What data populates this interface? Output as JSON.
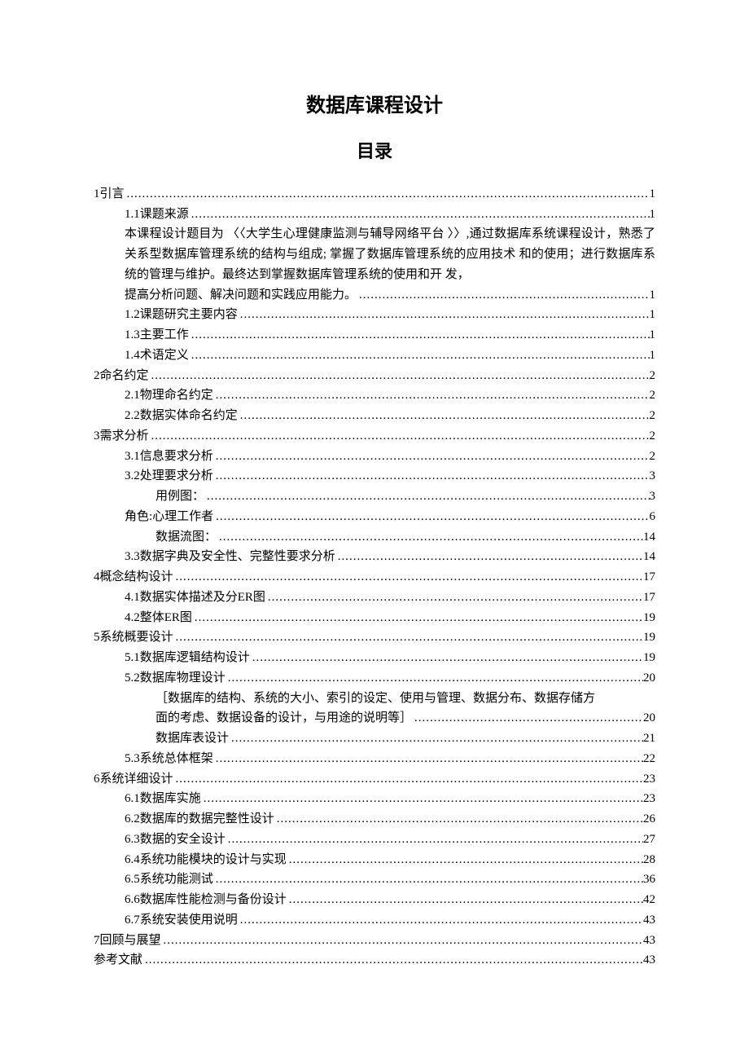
{
  "title": "数据库课程设计",
  "subtitle": "目录",
  "toc": [
    {
      "kind": "dotline",
      "indent": 0,
      "label": "1引言",
      "page": "1"
    },
    {
      "kind": "dotline",
      "indent": 1,
      "label": "1.1课题来源",
      "page": "1"
    },
    {
      "kind": "wrapblock",
      "indent": 1,
      "body": "本课程设计题目为 〈〈大学生心理健康监测与辅导网络平台  〉〉,通过数据库系统课程设计，熟悉了关系型数据库管理系统的结构与组成;  掌握了数据库管理系统的应用技术  和的使用；进行数据库系统的管理与维护。最终达到掌握数据库管理系统的使用和开  发，",
      "last": "提高分析问题、解决问题和实践应用能力。",
      "page": "1"
    },
    {
      "kind": "dotline",
      "indent": 1,
      "label": "1.2课题研究主要内容",
      "page": "1"
    },
    {
      "kind": "dotline",
      "indent": 1,
      "label": "1.3主要工作",
      "page": "1"
    },
    {
      "kind": "dotline",
      "indent": 1,
      "label": "1.4术语定义",
      "page": "1"
    },
    {
      "kind": "dotline",
      "indent": 0,
      "label": "2命名约定",
      "page": "2"
    },
    {
      "kind": "dotline",
      "indent": 1,
      "label": "2.1物理命名约定",
      "page": "2"
    },
    {
      "kind": "dotline",
      "indent": 1,
      "label": "2.2数据实体命名约定",
      "page": "2"
    },
    {
      "kind": "dotline",
      "indent": 0,
      "label": "3需求分析",
      "page": "2"
    },
    {
      "kind": "dotline",
      "indent": 1,
      "label": "3.1信息要求分析",
      "page": "2"
    },
    {
      "kind": "dotline",
      "indent": 1,
      "label": "3.2处理要求分析",
      "page": "3"
    },
    {
      "kind": "dotline",
      "indent": 2,
      "label": "用例图：",
      "page": "3"
    },
    {
      "kind": "dotline",
      "indent": 1,
      "label": "角色:心理工作者",
      "page": "6"
    },
    {
      "kind": "dotline",
      "indent": 2,
      "label": "数据流图：",
      "page": "14"
    },
    {
      "kind": "dotline",
      "indent": 1,
      "label": "3.3数据字典及安全性、完整性要求分析",
      "page": "14"
    },
    {
      "kind": "dotline",
      "indent": 0,
      "label": "4概念结构设计",
      "page": "17"
    },
    {
      "kind": "dotline",
      "indent": 1,
      "label": "4.1数据实体描述及分ER图",
      "page": "17"
    },
    {
      "kind": "dotline",
      "indent": 1,
      "label": "4.2整体ER图",
      "page": "19"
    },
    {
      "kind": "dotline",
      "indent": 0,
      "label": "5系统概要设计",
      "page": "19"
    },
    {
      "kind": "dotline",
      "indent": 1,
      "label": "5.1数据库逻辑结构设计",
      "page": "19"
    },
    {
      "kind": "dotline",
      "indent": 1,
      "label": "5.2数据库物理设计",
      "page": "20"
    },
    {
      "kind": "wrapblock",
      "indent": 2,
      "body": "［数据库的结构、系统的大小、索引的设定、使用与管理、数据分布、数据存储方",
      "last": "面的考虑、数据设备的设计，与用途的说明等］",
      "page": "20"
    },
    {
      "kind": "dotline",
      "indent": 2,
      "label": "数据库表设计",
      "page": "21"
    },
    {
      "kind": "dotline",
      "indent": 1,
      "label": "5.3系统总体框架",
      "page": "22"
    },
    {
      "kind": "dotline",
      "indent": 0,
      "label": "6系统详细设计",
      "page": "23"
    },
    {
      "kind": "dotline",
      "indent": 1,
      "label": "6.1数据库实施",
      "page": "23"
    },
    {
      "kind": "dotline",
      "indent": 1,
      "label": "6.2数据库的数据完整性设计",
      "page": "26"
    },
    {
      "kind": "dotline",
      "indent": 1,
      "label": "6.3数据的安全设计",
      "page": "27"
    },
    {
      "kind": "dotline",
      "indent": 1,
      "label": "6.4系统功能模块的设计与实现",
      "page": "28"
    },
    {
      "kind": "dotline",
      "indent": 1,
      "label": "6.5系统功能测试",
      "page": "36"
    },
    {
      "kind": "dotline",
      "indent": 1,
      "label": "6.6数据库性能检测与备份设计",
      "page": "42"
    },
    {
      "kind": "dotline",
      "indent": 1,
      "label": "6.7系统安装使用说明",
      "page": "43"
    },
    {
      "kind": "dotline",
      "indent": 0,
      "label": "7回顾与展望",
      "page": "43"
    },
    {
      "kind": "dotline",
      "indent": 0,
      "label": "参考文献",
      "page": "43"
    }
  ]
}
